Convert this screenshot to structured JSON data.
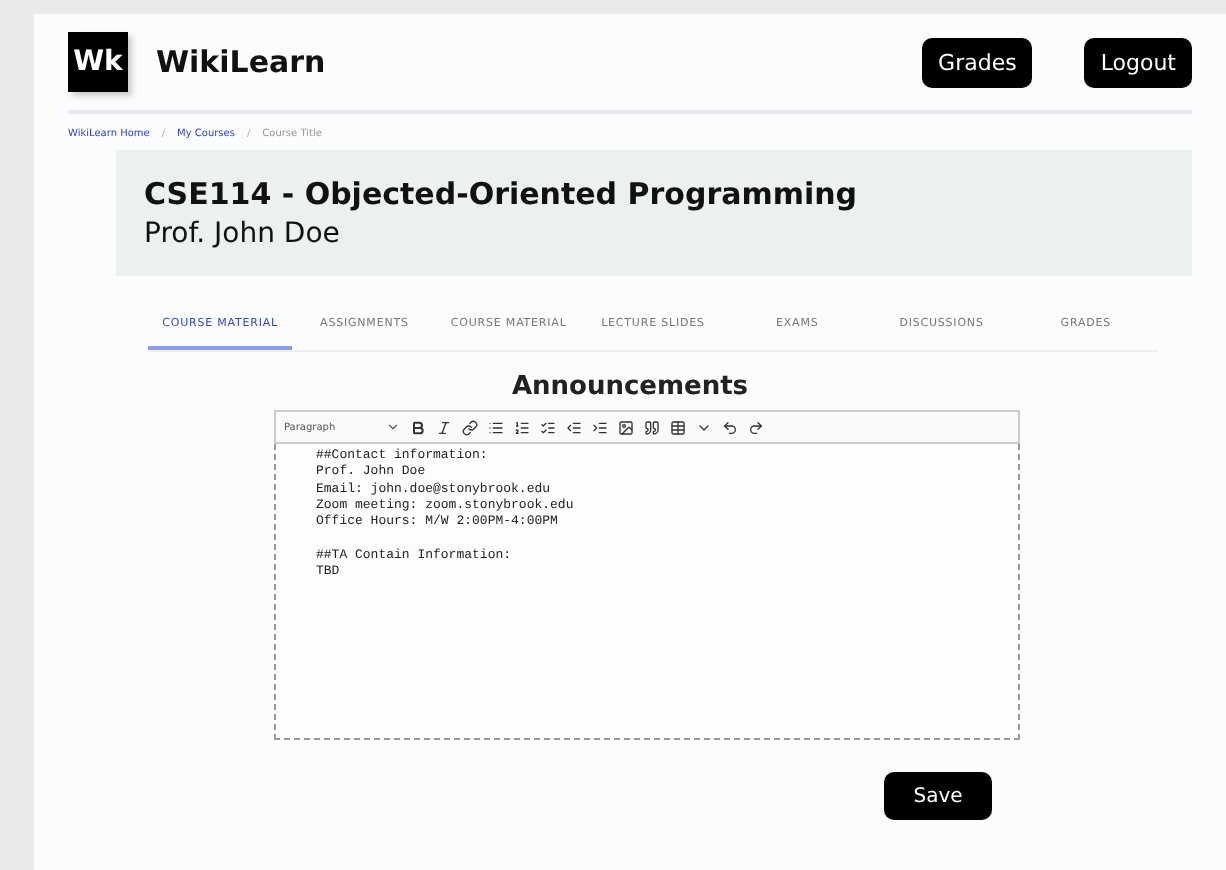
{
  "brand": {
    "logo": "Wk",
    "name": "WikiLearn"
  },
  "nav_buttons": [
    "Grades",
    "Logout"
  ],
  "breadcrumb": [
    {
      "label": "WikiLearn Home",
      "kind": "link"
    },
    {
      "label": "/",
      "kind": "separator"
    },
    {
      "label": "My Courses",
      "kind": "link"
    },
    {
      "label": "/",
      "kind": "separator"
    },
    {
      "label": "Course Title",
      "kind": "current"
    }
  ],
  "course": {
    "title": "CSE114 - Objected-Oriented Programming",
    "instructor": "Prof. John Doe"
  },
  "tabs": [
    {
      "label": "COURSE MATERIAL",
      "selected": true
    },
    {
      "label": "ASSIGNMENTS",
      "selected": false
    },
    {
      "label": "COURSE MATERIAL",
      "selected": false
    },
    {
      "label": "LECTURE SLIDES",
      "selected": false
    },
    {
      "label": "EXAMS",
      "selected": false
    },
    {
      "label": "DISCUSSIONS",
      "selected": false
    },
    {
      "label": "GRADES",
      "selected": false
    }
  ],
  "heading": "Announcements",
  "editor": {
    "format": "Paragraph",
    "content": "##Contact information:\nProf. John Doe\nEmail: john.doe@stonybrook.edu\nZoom meeting: zoom.stonybrook.edu\nOffice Hours: M/W 2:00PM-4:00PM\n\n##TA Contain Information:\nTBD"
  },
  "save_button": "Save"
}
